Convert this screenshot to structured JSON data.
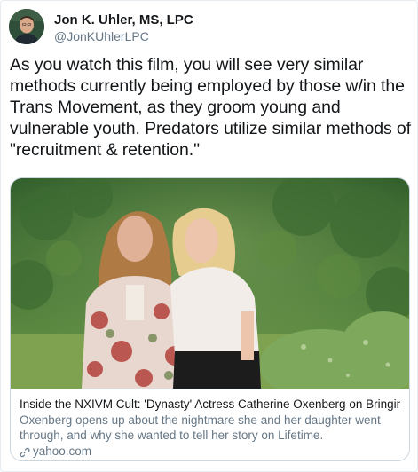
{
  "author": {
    "name": "Jon K. Uhler, MS, LPC",
    "handle": "@JonKUhlerLPC"
  },
  "tweet": {
    "text": "As you watch this film, you will see very similar methods currently being employed by those w/in the Trans Movement, as they groom young and vulnerable youth. Predators utilize similar methods of \"recruitment & retention.\""
  },
  "card": {
    "title": "Inside the NXIVM Cult: 'Dynasty' Actress Catherine Oxenberg on Bringing ...",
    "description": "Oxenberg opens up about the nightmare she and her daughter went through, and why she wanted to tell her story on Lifetime.",
    "domain": "yahoo.com",
    "domain_icon": "link-icon"
  },
  "colors": {
    "text": "#14171a",
    "secondary": "#657786",
    "border": "#ccd6dd"
  }
}
